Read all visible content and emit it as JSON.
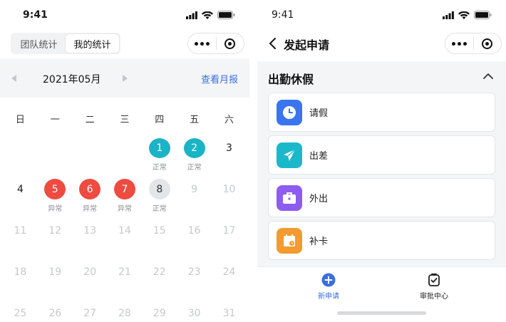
{
  "status_bar": {
    "time": "9:41"
  },
  "left": {
    "segment": {
      "team_label": "团队统计",
      "mine_label": "我的统计"
    },
    "month_bar": {
      "month": "2021年05月",
      "report_link": "查看月报"
    },
    "weekdays": [
      "日",
      "一",
      "二",
      "三",
      "四",
      "五",
      "六"
    ],
    "weeks": [
      [
        {
          "day": "",
          "state": "empty"
        },
        {
          "day": "",
          "state": "empty"
        },
        {
          "day": "",
          "state": "empty"
        },
        {
          "day": "",
          "state": "empty"
        },
        {
          "day": "1",
          "state": "normal",
          "label": "正常"
        },
        {
          "day": "2",
          "state": "normal",
          "label": "正常"
        },
        {
          "day": "3",
          "state": "active"
        }
      ],
      [
        {
          "day": "4",
          "state": "active"
        },
        {
          "day": "5",
          "state": "abnormal",
          "label": "异常"
        },
        {
          "day": "6",
          "state": "abnormal",
          "label": "异常"
        },
        {
          "day": "7",
          "state": "abnormal",
          "label": "异常"
        },
        {
          "day": "8",
          "state": "today",
          "label": "正常"
        },
        {
          "day": "9",
          "state": "future"
        },
        {
          "day": "10",
          "state": "future"
        }
      ],
      [
        {
          "day": "11",
          "state": "future"
        },
        {
          "day": "12",
          "state": "future"
        },
        {
          "day": "13",
          "state": "future"
        },
        {
          "day": "14",
          "state": "future"
        },
        {
          "day": "15",
          "state": "future"
        },
        {
          "day": "16",
          "state": "future"
        },
        {
          "day": "17",
          "state": "future"
        }
      ],
      [
        {
          "day": "18",
          "state": "future"
        },
        {
          "day": "19",
          "state": "future"
        },
        {
          "day": "20",
          "state": "future"
        },
        {
          "day": "21",
          "state": "future"
        },
        {
          "day": "22",
          "state": "future"
        },
        {
          "day": "23",
          "state": "future"
        },
        {
          "day": "24",
          "state": "future"
        }
      ],
      [
        {
          "day": "25",
          "state": "future"
        },
        {
          "day": "26",
          "state": "future"
        },
        {
          "day": "27",
          "state": "future"
        },
        {
          "day": "28",
          "state": "future"
        },
        {
          "day": "29",
          "state": "future"
        },
        {
          "day": "30",
          "state": "future"
        },
        {
          "day": "31",
          "state": "future"
        }
      ]
    ]
  },
  "right": {
    "nav_title": "发起申请",
    "section_title": "出勤休假",
    "items": [
      {
        "label": "请假",
        "icon": "clock-icon",
        "color": "#3a74f0"
      },
      {
        "label": "出差",
        "icon": "airplane-icon",
        "color": "#1bb8c9"
      },
      {
        "label": "外出",
        "icon": "briefcase-icon",
        "color": "#8e5cf0"
      },
      {
        "label": "补卡",
        "icon": "calendar-icon",
        "color": "#f49a2e"
      }
    ],
    "tabbar": {
      "new_label": "新申请",
      "center_label": "审批中心"
    }
  },
  "colors": {
    "accent": "#3a6fdb",
    "normal": "#1bb3c6",
    "abnormal": "#ee4b41"
  }
}
